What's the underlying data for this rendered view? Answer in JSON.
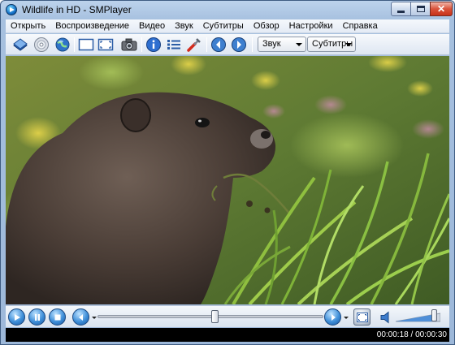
{
  "window": {
    "title": "Wildlife in HD - SMPlayer",
    "close_label": "✕"
  },
  "menu": [
    {
      "label": "Открыть"
    },
    {
      "label": "Воспроизведение"
    },
    {
      "label": "Видео"
    },
    {
      "label": "Звук"
    },
    {
      "label": "Субтитры"
    },
    {
      "label": "Обзор"
    },
    {
      "label": "Настройки"
    },
    {
      "label": "Справка"
    }
  ],
  "toolbar": {
    "icons": [
      "open-file-icon",
      "open-disc-icon",
      "open-url-icon",
      "normal-size-icon",
      "fullscreen-icon",
      "screenshot-icon",
      "info-icon",
      "playlist-icon",
      "preferences-icon",
      "previous-icon",
      "next-icon"
    ],
    "audio_combo": "Звук",
    "subtitles_combo": "Субтитры"
  },
  "player": {
    "progress_fraction": 0.52,
    "volume_fraction": 0.86,
    "time_current": "00:00:18",
    "time_total": "00:00:30",
    "time_separator": " / "
  },
  "colors": {
    "accent_blue": "#2f7fd0",
    "titlebar": "#bcd3ec",
    "statusbar": "#000000"
  }
}
